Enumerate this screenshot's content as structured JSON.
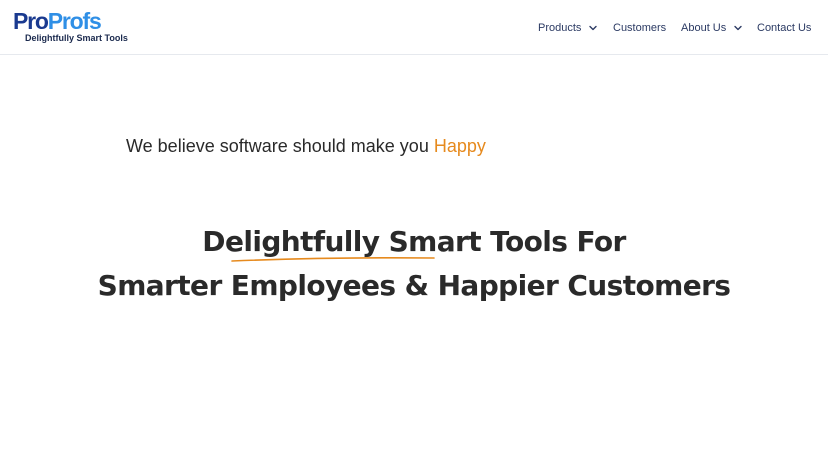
{
  "brand": {
    "wordmark_pro": "Pro",
    "wordmark_profs": "Profs",
    "tagline": "Delightfully Smart Tools",
    "colors": {
      "primary": "#1a3a8f",
      "secondary": "#2f8fe6",
      "accent": "#e68a1e"
    }
  },
  "nav": {
    "products": "Products",
    "customers": "Customers",
    "about": "About Us",
    "contact": "Contact Us",
    "chevron_icon": "chevron-down-icon"
  },
  "hero": {
    "belief_prefix": "We believe software should make you ",
    "belief_highlight": "Happy",
    "headline_line1": "Delightfully Smart Tools For",
    "headline_line2": "Smarter Employees & Happier Customers"
  }
}
